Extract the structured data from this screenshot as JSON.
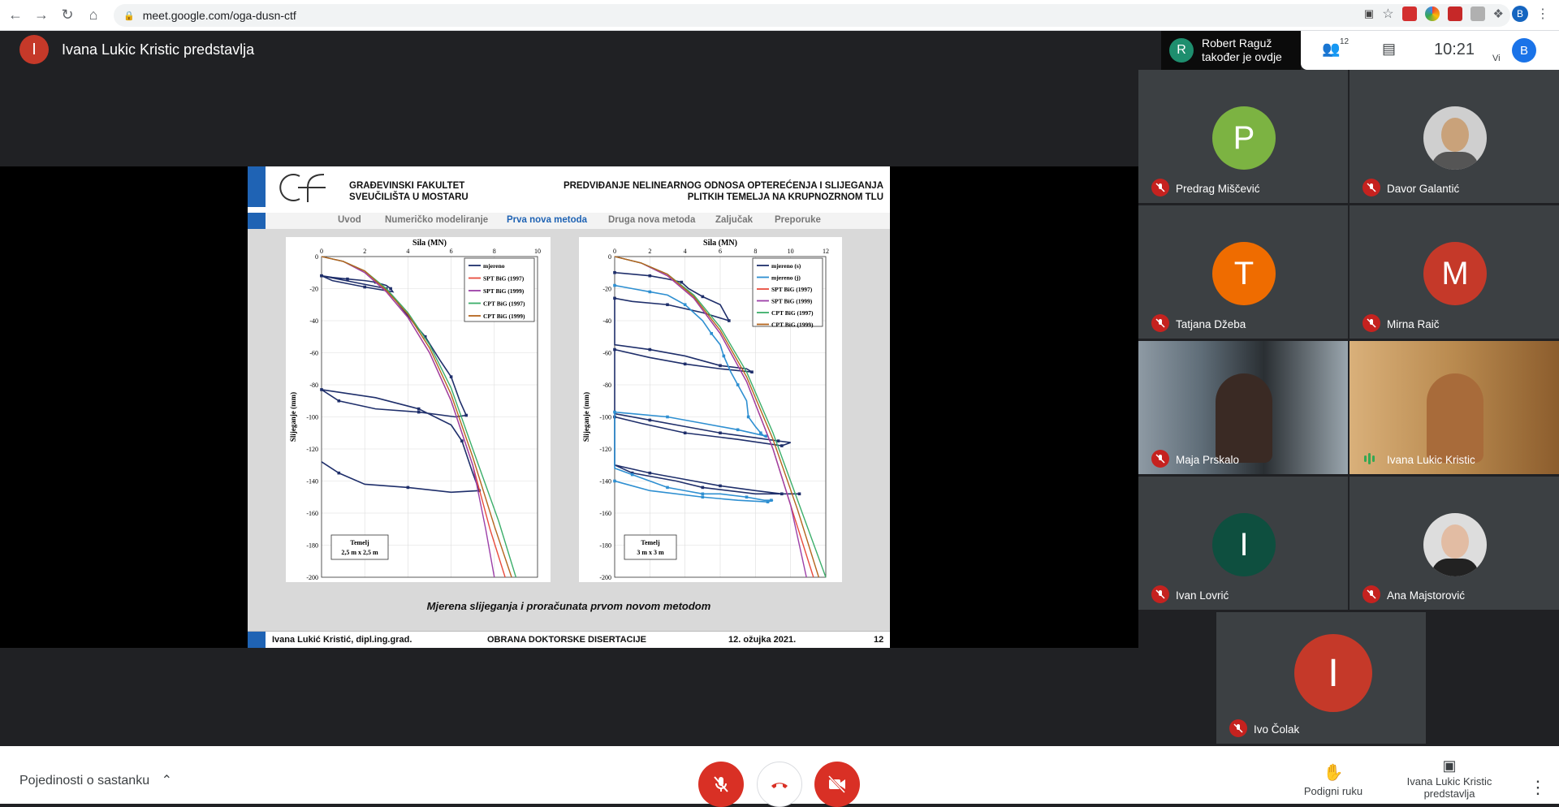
{
  "browser": {
    "url": "meet.google.com/oga-dusn-ctf"
  },
  "presenter": {
    "avatar_letter": "I",
    "text": "Ivana Lukic Kristic predstavlja"
  },
  "notification": {
    "avatar_letter": "R",
    "line1": "Robert Raguž",
    "line2": "također je ovdje"
  },
  "top_right": {
    "participants_count": "12",
    "clock": "10:21",
    "self_avatar_letter": "B",
    "self_label": "Vi"
  },
  "slide": {
    "header_left": [
      "GRAĐEVINSKI FAKULTET",
      "SVEUČILIŠTA U MOSTARU"
    ],
    "header_right": [
      "PREDVIĐANJE NELINEARNOG ODNOSA OPTEREĆENJA I SLIJEGANJA",
      "PLITKIH TEMELJA NA KRUPNOZRNOM TLU"
    ],
    "nav": [
      "Uvod",
      "Numeričko modeliranje",
      "Prva nova metoda",
      "Druga nova metoda",
      "Zaljučak",
      "Preporuke"
    ],
    "nav_active_index": 2,
    "caption": "Mjerena slijeganja i proračunata prvom novom metodom",
    "footer_author": "Ivana Lukić Kristić, dipl.ing.grad.",
    "footer_title": "OBRANA DOKTORSKE DISERTACIJE",
    "footer_date": "12. ožujka 2021.",
    "footer_page": "12"
  },
  "chart_data": [
    {
      "type": "line",
      "title": "Sila (MN)",
      "xlabel": "Sila (MN)",
      "ylabel": "Slijeganje (mm)",
      "xlim": [
        0,
        10
      ],
      "ylim": [
        -200,
        0
      ],
      "x_ticks": [
        0,
        2,
        4,
        6,
        8,
        10
      ],
      "y_ticks": [
        0,
        -20,
        -40,
        -60,
        -80,
        -100,
        -120,
        -140,
        -160,
        -180,
        -200
      ],
      "annotation": [
        "Temelj",
        "2,5 m x 2,5 m"
      ],
      "legend_position": "top-right",
      "series": [
        {
          "name": "mjereno",
          "color": "#1f2f6b",
          "x": [
            0,
            0.5,
            1.2,
            2.0,
            2.5,
            3.0,
            3.2,
            3.3,
            2.0,
            0.5,
            0,
            1.5,
            3,
            4.3,
            4.8,
            5.5,
            6.0,
            6.4,
            6.7,
            6.2,
            4.5,
            2.5,
            0.8,
            0,
            0,
            2.5,
            4.5,
            6.0,
            6.5,
            7.0,
            7.3,
            6.0,
            4.0,
            2.0,
            0.8,
            0
          ],
          "y": [
            -12,
            -13,
            -14,
            -15,
            -16,
            -18,
            -20,
            -22,
            -19,
            -15,
            -12,
            -16,
            -20,
            -42,
            -50,
            -65,
            -75,
            -90,
            -99,
            -100,
            -97,
            -95,
            -90,
            -83,
            -83,
            -88,
            -95,
            -105,
            -115,
            -135,
            -146,
            -147,
            -144,
            -142,
            -135,
            -128
          ]
        },
        {
          "name": "SPT BiG (1997)",
          "color": "#e84c3d",
          "x": [
            0,
            1,
            2,
            3,
            4,
            5,
            6,
            7,
            7.8,
            8.5
          ],
          "y": [
            0,
            -3,
            -10,
            -22,
            -38,
            -60,
            -90,
            -130,
            -170,
            -200
          ]
        },
        {
          "name": "SPT BiG (1999)",
          "color": "#9c3fa8",
          "x": [
            0,
            1,
            2,
            3,
            4,
            5,
            6,
            7,
            7.6,
            8.0
          ],
          "y": [
            0,
            -3,
            -10,
            -22,
            -38,
            -60,
            -90,
            -130,
            -170,
            -200
          ]
        },
        {
          "name": "CPT BiG (1997)",
          "color": "#3bae6a",
          "x": [
            0,
            1,
            2,
            3,
            4,
            5,
            6,
            7,
            8.2,
            9.0
          ],
          "y": [
            0,
            -3,
            -9,
            -20,
            -35,
            -55,
            -82,
            -120,
            -165,
            -200
          ]
        },
        {
          "name": "CPT BiG (1999)",
          "color": "#b5651d",
          "x": [
            0,
            1,
            2,
            3,
            4,
            5,
            6,
            7,
            8.0,
            8.8
          ],
          "y": [
            0,
            -3,
            -9,
            -21,
            -36,
            -57,
            -86,
            -125,
            -168,
            -200
          ]
        }
      ]
    },
    {
      "type": "line",
      "title": "Sila (MN)",
      "xlabel": "Sila (MN)",
      "ylabel": "Slijeganje (mm)",
      "xlim": [
        0,
        12
      ],
      "ylim": [
        -200,
        0
      ],
      "x_ticks": [
        0,
        2,
        4,
        6,
        8,
        10,
        12
      ],
      "y_ticks": [
        0,
        -20,
        -40,
        -60,
        -80,
        -100,
        -120,
        -140,
        -160,
        -180,
        -200
      ],
      "annotation": [
        "Temelj",
        "3 m x 3 m"
      ],
      "legend_position": "top-right",
      "series": [
        {
          "name": "mjereno (s)",
          "color": "#1f2f6b",
          "x": [
            0,
            1,
            2,
            3,
            3.8,
            4.2,
            5,
            6,
            6.5,
            5,
            3,
            1,
            0,
            0,
            2,
            4,
            6,
            7.5,
            7.8,
            6,
            4,
            2,
            0,
            0,
            2,
            4,
            6,
            8,
            9.3,
            10.0,
            9.5,
            7,
            4,
            1.5,
            0,
            0,
            2,
            4,
            6,
            8,
            9.5,
            10.2,
            10.5,
            8,
            5,
            3.5,
            1,
            0
          ],
          "y": [
            -10,
            -11,
            -12,
            -14,
            -16,
            -20,
            -25,
            -30,
            -40,
            -35,
            -30,
            -28,
            -26,
            -55,
            -58,
            -62,
            -68,
            -70,
            -72,
            -70,
            -67,
            -63,
            -58,
            -98,
            -102,
            -106,
            -110,
            -113,
            -115,
            -116,
            -118,
            -114,
            -110,
            -104,
            -100,
            -130,
            -135,
            -139,
            -143,
            -146,
            -148,
            -148,
            -148,
            -148,
            -144,
            -140,
            -135,
            -130
          ]
        },
        {
          "name": "mjereno (j)",
          "color": "#2e8fd1",
          "x": [
            0,
            1,
            2,
            3,
            4,
            5,
            5.5,
            6.0,
            6.2,
            6.6,
            7.0,
            7.5,
            7.6,
            8.0,
            8.3,
            8.5,
            8.6,
            8.6,
            7.0,
            5.0,
            3.0,
            1.0,
            0,
            0,
            1,
            2,
            3,
            4,
            5,
            6,
            7.5,
            8.5,
            8.9,
            9.0,
            8.7,
            7.0,
            5.0,
            2.0,
            0
          ],
          "y": [
            -18,
            -20,
            -22,
            -24,
            -30,
            -40,
            -48,
            -55,
            -62,
            -72,
            -80,
            -90,
            -100,
            -106,
            -110,
            -112,
            -112,
            -112,
            -108,
            -104,
            -100,
            -98,
            -97,
            -132,
            -136,
            -140,
            -144,
            -146,
            -148,
            -148,
            -150,
            -152,
            -152,
            -152,
            -153,
            -152,
            -150,
            -146,
            -140
          ]
        },
        {
          "name": "SPT BiG (1997)",
          "color": "#e84c3d",
          "x": [
            0,
            1.5,
            3,
            4.5,
            6,
            7.5,
            9,
            10,
            11.3
          ],
          "y": [
            0,
            -4,
            -12,
            -26,
            -48,
            -78,
            -120,
            -155,
            -200
          ]
        },
        {
          "name": "SPT BiG (1999)",
          "color": "#9c3fa8",
          "x": [
            0,
            1.5,
            3,
            4.5,
            6,
            7.5,
            9,
            10,
            10.9
          ],
          "y": [
            0,
            -4,
            -12,
            -26,
            -48,
            -78,
            -120,
            -155,
            -200
          ]
        },
        {
          "name": "CPT BiG (1997)",
          "color": "#3bae6a",
          "x": [
            0,
            1.5,
            3,
            4.5,
            6,
            7.5,
            9,
            10.5,
            12.0
          ],
          "y": [
            0,
            -4,
            -11,
            -24,
            -44,
            -72,
            -110,
            -155,
            -200
          ]
        },
        {
          "name": "CPT BiG (1999)",
          "color": "#b5651d",
          "x": [
            0,
            1.5,
            3,
            4.5,
            6,
            7.5,
            9,
            10.4,
            11.6
          ],
          "y": [
            0,
            -4,
            -11,
            -25,
            -46,
            -75,
            -114,
            -158,
            -200
          ]
        }
      ]
    }
  ],
  "tiles": [
    {
      "name": "Predrag Miščević",
      "letter": "P",
      "color": "#7cb342",
      "type": "avatar"
    },
    {
      "name": "Davor Galantić",
      "letter": "",
      "color": "#cfcfcf",
      "type": "photo"
    },
    {
      "name": "Tatjana Džeba",
      "letter": "T",
      "color": "#ef6c00",
      "type": "avatar"
    },
    {
      "name": "Mirna Raič",
      "letter": "M",
      "color": "#c53929",
      "type": "avatar"
    },
    {
      "name": "Maja Prskalo",
      "letter": "",
      "color": "#5a6a78",
      "type": "video"
    },
    {
      "name": "Ivana Lukic Kristic",
      "letter": "",
      "color": "#b5854e",
      "type": "video"
    },
    {
      "name": "Ivan Lovrić",
      "letter": "I",
      "color": "#0e4f3f",
      "type": "avatar"
    },
    {
      "name": "Ana Majstorović",
      "letter": "",
      "color": "#dddddd",
      "type": "photo"
    },
    {
      "name": "Ivo Čolak",
      "letter": "I",
      "color": "#c53929",
      "type": "avatar"
    }
  ],
  "bottom": {
    "meeting_details": "Pojedinosti o sastanku",
    "raise_hand": "Podigni ruku",
    "presenting": [
      "Ivana Lukic Kristic",
      "predstavlja"
    ]
  }
}
